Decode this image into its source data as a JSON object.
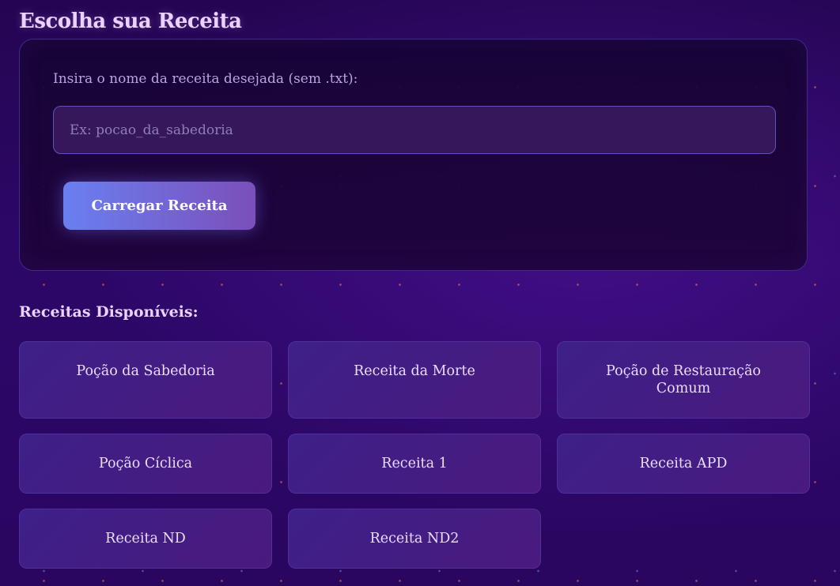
{
  "page": {
    "title": "Escolha sua Receita"
  },
  "loader": {
    "label": "Insira o nome da receita desejada (sem .txt):",
    "input_value": "",
    "input_placeholder": "Ex: pocao_da_sabedoria",
    "button_label": "Carregar Receita"
  },
  "recipes": {
    "heading": "Receitas Disponíveis:",
    "items": [
      {
        "label": "Poção da Sabedoria"
      },
      {
        "label": "Receita da Morte"
      },
      {
        "label": "Poção de Restauração Comum"
      },
      {
        "label": "Poção Cíclica"
      },
      {
        "label": "Receita 1"
      },
      {
        "label": "Receita APD"
      },
      {
        "label": "Receita ND"
      },
      {
        "label": "Receita ND2"
      }
    ]
  },
  "colors": {
    "background": "#2a0660",
    "panel_border": "#3b2c8a",
    "accent_start": "#6a7ff0",
    "accent_end": "#7b4fba",
    "card": "#3d2088",
    "title_text": "#e9d2ff"
  }
}
